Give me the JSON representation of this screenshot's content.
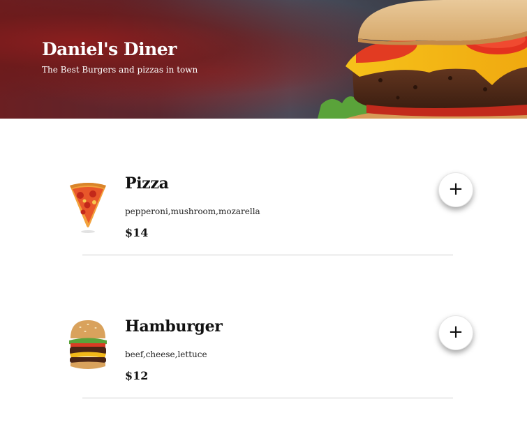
{
  "header": {
    "title": "Daniel's Diner",
    "subtitle": "The Best Burgers and pizzas in town",
    "image_icon": "burger-banner-image"
  },
  "menu": {
    "items": [
      {
        "name": "Pizza",
        "ingredients": "pepperoni,mushroom,mozarella",
        "price": "$14",
        "icon": "pizza-slice-image",
        "add_label": "+"
      },
      {
        "name": "Hamburger",
        "ingredients": "beef,cheese,lettuce",
        "price": "$12",
        "icon": "hamburger-image",
        "add_label": "+"
      }
    ]
  },
  "colors": {
    "background": "#ffffff",
    "text": "#111111",
    "divider": "#cfcfcf",
    "hero_text": "#ffffff"
  }
}
